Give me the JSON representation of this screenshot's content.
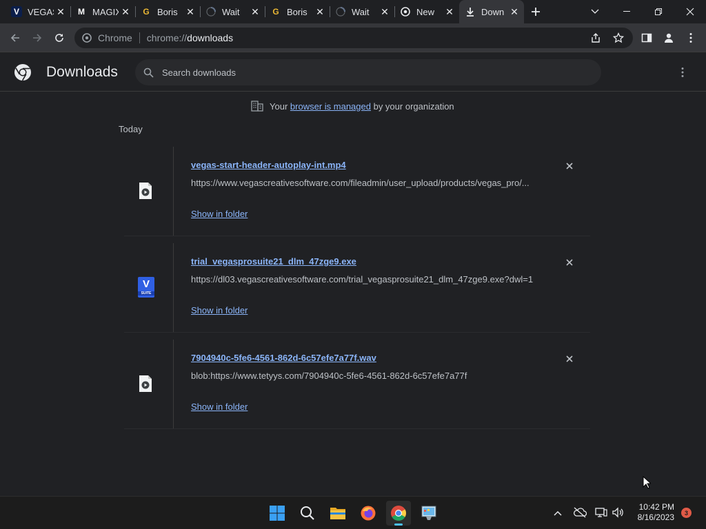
{
  "tabs": [
    {
      "title": "VEGAS",
      "favicon": "vegas-v",
      "favicon_color": "#0b1e4b",
      "letter": "V",
      "active": false,
      "loading": false
    },
    {
      "title": "MAGIX",
      "favicon": "magix-m",
      "favicon_color": "#ffffff",
      "letter": "M",
      "active": false,
      "loading": false
    },
    {
      "title": "Boris",
      "favicon": "g-icon",
      "favicon_color": "#e8b634",
      "letter": "G",
      "active": false,
      "loading": false
    },
    {
      "title": "Wait",
      "favicon": "spinner",
      "favicon_color": "#9aa0a6",
      "letter": "",
      "active": false,
      "loading": true
    },
    {
      "title": "Boris",
      "favicon": "g-icon",
      "favicon_color": "#e8b634",
      "letter": "G",
      "active": false,
      "loading": false
    },
    {
      "title": "Wait",
      "favicon": "spinner",
      "favicon_color": "#9aa0a6",
      "letter": "",
      "active": false,
      "loading": true
    },
    {
      "title": "New",
      "favicon": "chrome-icon",
      "favicon_color": "#e8eaed",
      "letter": "",
      "active": false,
      "loading": false
    },
    {
      "title": "Down",
      "favicon": "download-icon",
      "favicon_color": "#e8eaed",
      "letter": "",
      "active": true,
      "loading": false
    }
  ],
  "omnibox": {
    "site_label": "Chrome",
    "url_prefix": "chrome://",
    "url_host": "downloads"
  },
  "downloads_page": {
    "title": "Downloads",
    "search_placeholder": "Search downloads",
    "managed_prefix": "Your",
    "managed_link": "browser is managed",
    "managed_suffix": "by your organization",
    "date_group": "Today",
    "show_in_folder_label": "Show in folder",
    "items": [
      {
        "filename": "vegas-start-header-autoplay-int.mp4",
        "url": "https://www.vegascreativesoftware.com/fileadmin/user_upload/products/vegas_pro/...",
        "icon": "media-file-icon"
      },
      {
        "filename": "trial_vegasprosuite21_dlm_47zge9.exe",
        "url": "https://dl03.vegascreativesoftware.com/trial_vegasprosuite21_dlm_47zge9.exe?dwl=1",
        "icon": "vegas-suite-icon",
        "icon_letter": "V",
        "icon_sub": "SUITE"
      },
      {
        "filename": "7904940c-5fe6-4561-862d-6c57efe7a77f.wav",
        "url": "blob:https://www.tetyys.com/7904940c-5fe6-4561-862d-6c57efe7a77f",
        "icon": "media-file-icon"
      }
    ]
  },
  "taskbar": {
    "time": "10:42 PM",
    "date": "8/16/2023",
    "notification_count": "3"
  },
  "colors": {
    "accent_link": "#8ab4f8",
    "page_bg": "#202124",
    "toolbar_bg": "#35363a"
  }
}
